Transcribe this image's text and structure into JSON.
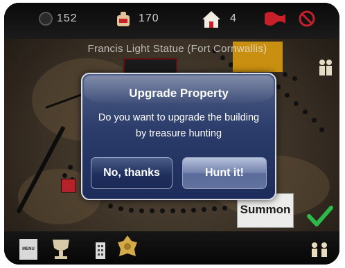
{
  "topbar": {
    "cash": "152",
    "population": "170",
    "houses": "4",
    "icons": [
      "coin-icon",
      "bag-icon",
      "house-icon",
      "flag-icon",
      "no-entry-icon"
    ]
  },
  "board": {
    "caption": "Francis Light Statue (Fort Cornwallis)"
  },
  "dialog": {
    "title": "Upgrade Property",
    "message_line1": "Do you want to upgrade the building",
    "message_line2": "by treasure hunting",
    "cancel_label": "No, thanks",
    "confirm_label": "Hunt it!"
  },
  "summon": {
    "label": "Summon"
  },
  "bottombar": {
    "card_text": "MENU",
    "icons": [
      "card-icon",
      "trophy-icon",
      "building-icon",
      "badge-icon",
      "players-icon"
    ]
  },
  "colors": {
    "dialog_top": "#4f5f86",
    "dialog_bottom": "#1c2c5a",
    "confirm_top": "#b6c1db",
    "check_green": "#2db84a",
    "flag_red": "#c8202a"
  }
}
